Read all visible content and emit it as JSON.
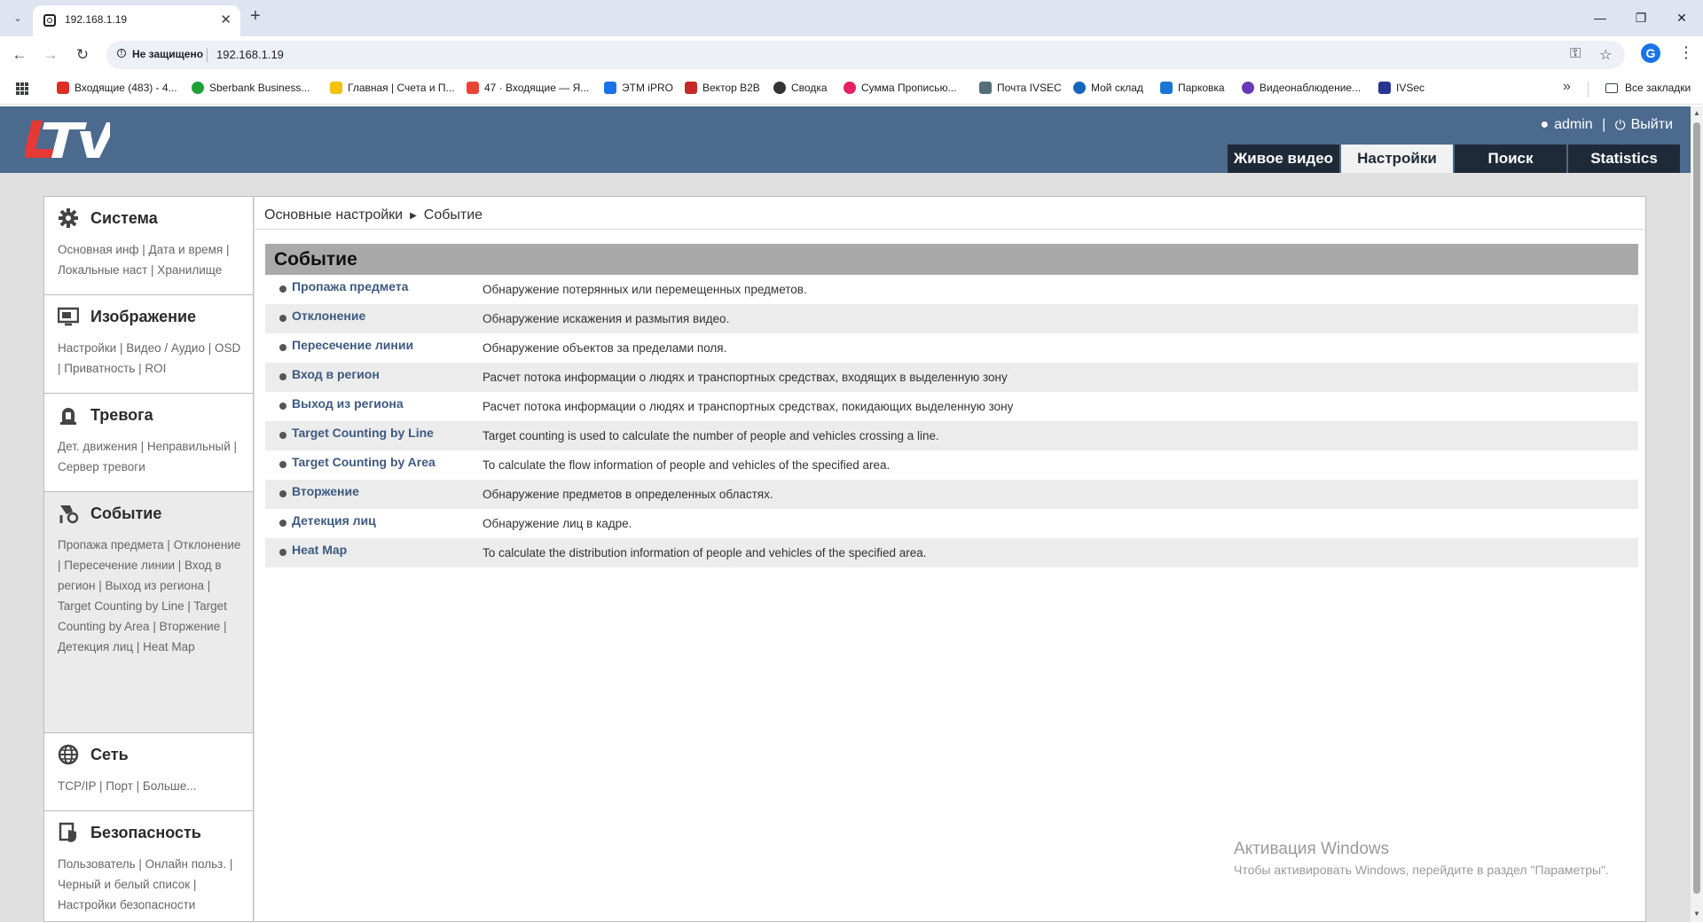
{
  "browser": {
    "tab_title": "192.168.1.19",
    "security_label": "Не защищено",
    "url": "192.168.1.19",
    "bookmarks": [
      {
        "label": "Входящие (483) - 4...",
        "color": "#d93025"
      },
      {
        "label": "Sberbank Business...",
        "color": "#21a038"
      },
      {
        "label": "Главная | Счета и П...",
        "color": "#f4c20d"
      },
      {
        "label": "47 · Входящие — Я...",
        "color": "#ea4335"
      },
      {
        "label": "ЭТМ iPRO",
        "color": "#1a73e8"
      },
      {
        "label": "Вектор B2B",
        "color": "#c62828"
      },
      {
        "label": "Сводка",
        "color": "#333333"
      },
      {
        "label": "Сумма Прописью...",
        "color": "#e91e63"
      },
      {
        "label": "Почта IVSEC",
        "color": "#546e7a"
      },
      {
        "label": "Мой склад",
        "color": "#1565c0"
      },
      {
        "label": "Парковка",
        "color": "#1976d2"
      },
      {
        "label": "Видеонаблюдение...",
        "color": "#673ab7"
      },
      {
        "label": "IVSec",
        "color": "#283593"
      }
    ],
    "all_bookmarks": "Все закладки"
  },
  "header": {
    "logo": "LTV",
    "user": "admin",
    "logout": "Выйти",
    "tabs": [
      {
        "label": "Живое видео",
        "active": false
      },
      {
        "label": "Настройки",
        "active": true
      },
      {
        "label": "Поиск",
        "active": false
      },
      {
        "label": "Statistics",
        "active": false
      }
    ]
  },
  "sidebar": {
    "sections": [
      {
        "title": "Система",
        "icon": "gear-icon",
        "links": "Основная инф | Дата и время | Локальные наст | Хранилище"
      },
      {
        "title": "Изображение",
        "icon": "monitor-icon",
        "links": "Настройки | Видео / Аудио | OSD | Приватность | ROI"
      },
      {
        "title": "Тревога",
        "icon": "alarm-icon",
        "links": "Дет. движения | Неправильный | Сервер тревоги"
      },
      {
        "title": "Событие",
        "icon": "event-icon",
        "links": "Пропажа предмета | Отклонение | Пересечение линии | Вход в регион | Выход из региона | Target Counting by Line | Target Counting by Area | Вторжение | Детекция лиц | Heat Map"
      },
      {
        "title": "Сеть",
        "icon": "globe-icon",
        "links": "TCP/IP | Порт | Больше..."
      },
      {
        "title": "Безопасность",
        "icon": "shield-icon",
        "links": "Пользователь | Онлайн польз. | Черный и белый список | Настройки безопасности"
      }
    ]
  },
  "main": {
    "breadcrumb": [
      "Основные настройки",
      "Событие"
    ],
    "title": "Событие",
    "events": [
      {
        "name": "Пропажа предмета",
        "desc": "Обнаружение потерянных или перемещенных предметов."
      },
      {
        "name": "Отклонение",
        "desc": "Обнаружение искажения и размытия видео."
      },
      {
        "name": "Пересечение линии",
        "desc": "Обнаружение объектов за пределами поля."
      },
      {
        "name": "Вход в регион",
        "desc": "Расчет потока информации о людях и транспортных средствах, входящих в выделенную зону"
      },
      {
        "name": "Выход из региона",
        "desc": "Расчет потока информации о людях и транспортных средствах, покидающих выделенную зону"
      },
      {
        "name": "Target Counting by Line",
        "desc": "Target counting is used to calculate the number of people and vehicles crossing a line."
      },
      {
        "name": "Target Counting by Area",
        "desc": "To calculate the flow information of people and vehicles of the specified area."
      },
      {
        "name": "Вторжение",
        "desc": "Обнаружение предметов в определенных областях."
      },
      {
        "name": "Детекция лиц",
        "desc": "Обнаружение лиц в кадре."
      },
      {
        "name": "Heat Map",
        "desc": "To calculate the distribution information of people and vehicles of the specified area."
      }
    ]
  },
  "watermark": {
    "title": "Активация Windows",
    "subtitle": "Чтобы активировать Windows, перейдите в раздел \"Параметры\"."
  }
}
